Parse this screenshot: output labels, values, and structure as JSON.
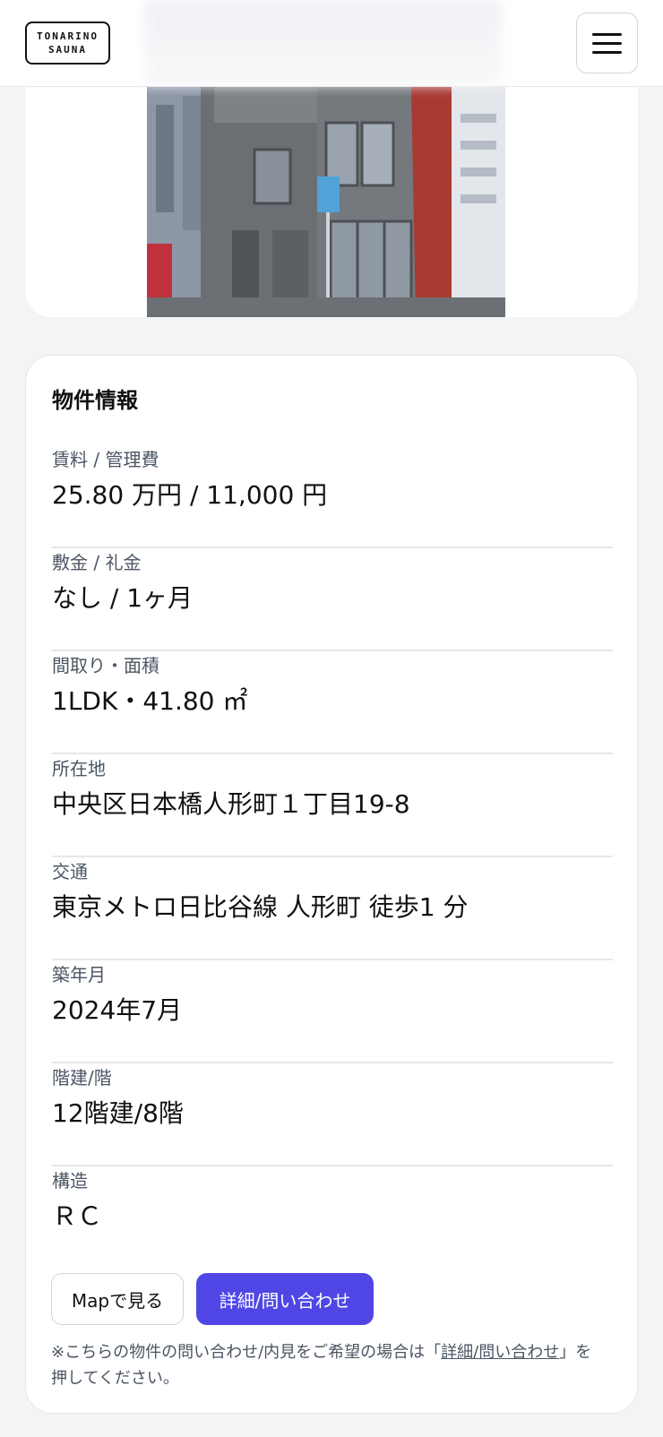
{
  "header": {
    "logo_line1": "TONARINO",
    "logo_line2": "SAUNA"
  },
  "property": {
    "section_title": "物件情報",
    "rows": [
      {
        "label": "賃料 / 管理費",
        "value": "25.80 万円 / 11,000 円"
      },
      {
        "label": "敷金 / 礼金",
        "value": "なし / 1ヶ月"
      },
      {
        "label": "間取り・面積",
        "value": "1LDK・41.80 ㎡"
      },
      {
        "label": "所在地",
        "value": "中央区日本橋人形町１丁目19-8"
      },
      {
        "label": "交通",
        "value": "東京メトロ日比谷線 人形町 徒歩1 分"
      },
      {
        "label": "築年月",
        "value": "2024年7月"
      },
      {
        "label": "階建/階",
        "value": "12階建/8階"
      },
      {
        "label": "構造",
        "value": "ＲＣ"
      }
    ]
  },
  "actions": {
    "map_label": "Mapで見る",
    "contact_label": "詳細/問い合わせ"
  },
  "note": {
    "prefix": "※こちらの物件の問い合わせ/内見をご希望の場合は「",
    "link": "詳細/問い合わせ",
    "suffix": "」を押してください。"
  },
  "colors": {
    "accent": "#4f46e5",
    "background": "#f3f4f6",
    "card": "#ffffff"
  }
}
